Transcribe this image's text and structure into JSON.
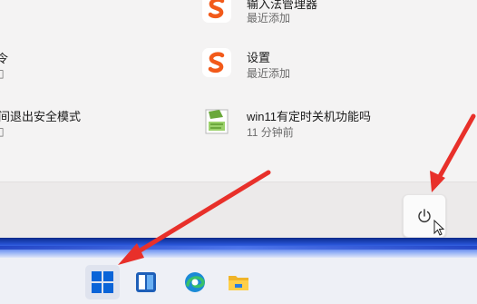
{
  "recent_left": [
    {
      "title": "",
      "subtitle": ""
    },
    {
      "title": "令",
      "subtitle": ""
    },
    {
      "title": "间退出安全模式",
      "subtitle": ""
    }
  ],
  "recent_right": [
    {
      "title": "输入法管理器",
      "subtitle": "最近添加",
      "icon": "sogou-icon"
    },
    {
      "title": "设置",
      "subtitle": "最近添加",
      "icon": "sogou-icon"
    },
    {
      "title": "win11有定时关机功能吗",
      "subtitle": "11 分钟前",
      "icon": "text-document-icon"
    }
  ],
  "power_button": {
    "icon": "power-icon"
  },
  "taskbar": {
    "items": [
      {
        "name": "start",
        "icon": "windows-start-icon"
      },
      {
        "name": "widgets",
        "icon": "widgets-icon"
      },
      {
        "name": "edge",
        "icon": "edge-browser-icon"
      },
      {
        "name": "file-explorer",
        "icon": "folder-icon"
      }
    ]
  },
  "colors": {
    "arrow": "#e8302a",
    "start_blue": "#0a64d8",
    "sogou_orange": "#f25a1a"
  }
}
